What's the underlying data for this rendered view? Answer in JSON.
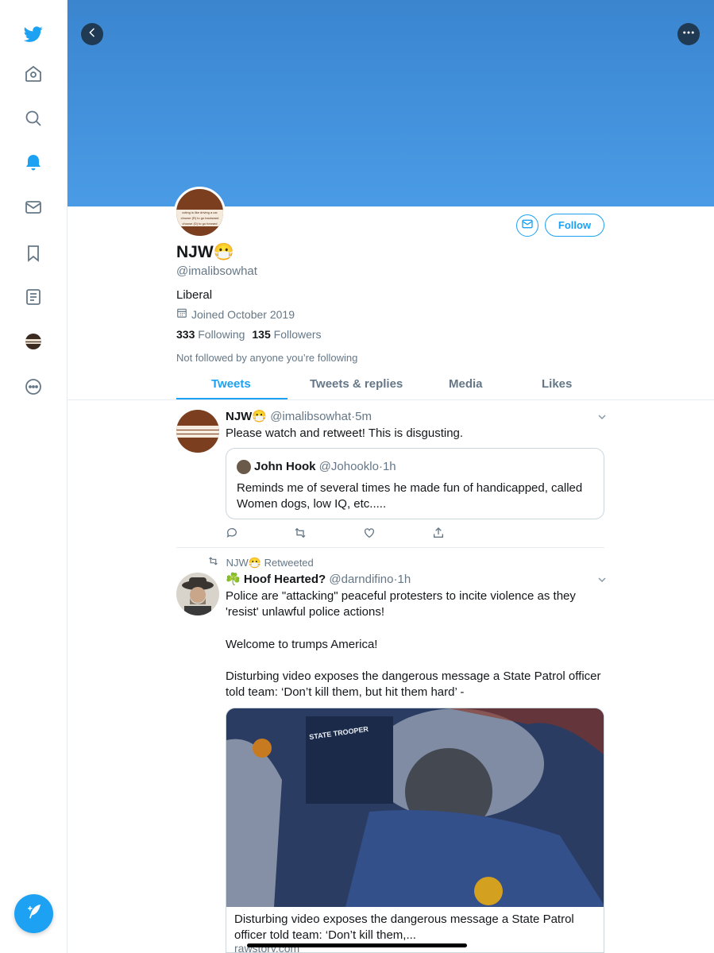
{
  "colors": {
    "accent": "#1da1f2",
    "banner": "#4a9be6",
    "text": "#14171a",
    "muted": "#657786"
  },
  "sidebar": {
    "icons": [
      "twitter-logo-icon",
      "home-icon",
      "search-icon",
      "notifications-bell-icon",
      "messages-mail-icon",
      "bookmark-icon",
      "lists-icon",
      "profile-avatar-icon",
      "more-icon"
    ],
    "compose_icon": "compose-feather-icon"
  },
  "header": {
    "back_icon": "back-chevron-icon",
    "more_icon": "more-dots-icon"
  },
  "profile": {
    "avatar_text": [
      "voting is like driving a car",
      "choose (R) to go backward",
      "choose (D) to go forward"
    ],
    "name": "NJW😷",
    "handle": "@imalibsowhat",
    "bio": "Liberal",
    "joined": "Joined October 2019",
    "following_count": "333",
    "following_label": "Following",
    "followers_count": "135",
    "followers_label": "Followers",
    "not_followed": "Not followed by anyone you’re following",
    "follow_button": "Follow"
  },
  "tabs": [
    {
      "label": "Tweets",
      "active": true
    },
    {
      "label": "Tweets & replies",
      "active": false
    },
    {
      "label": "Media",
      "active": false
    },
    {
      "label": "Likes",
      "active": false
    }
  ],
  "tweets": [
    {
      "name": "NJW😷",
      "handle": "@imalibsowhat",
      "sep": "·",
      "time": "5m",
      "text": "Please watch and retweet! This is disgusting.",
      "quote": {
        "name": "John Hook",
        "handle": "@Johooklo",
        "sep": "·",
        "time": "1h",
        "text": "Reminds me of several times he made fun of handicapped, called Women dogs, low IQ, etc....."
      }
    },
    {
      "retweet_by": "NJW😷",
      "retweet_label": "Retweeted",
      "name_prefix": "☘️",
      "name": "Hoof Hearted?",
      "handle": "@darndifino",
      "sep": "·",
      "time": "1h",
      "text_lines": [
        "Police are \"attacking\" peaceful protesters to incite violence as they 'resist' unlawful police actions!",
        "Welcome to trumps America!",
        "Disturbing video exposes the dangerous message a State Patrol officer told team: ‘Don’t kill them, but hit them hard’ -"
      ],
      "card": {
        "image_text": "STATE TROOPER",
        "title": "Disturbing video exposes the dangerous message a State Patrol officer told team: ‘Don’t kill them,...",
        "domain": "rawstory.com"
      }
    }
  ]
}
